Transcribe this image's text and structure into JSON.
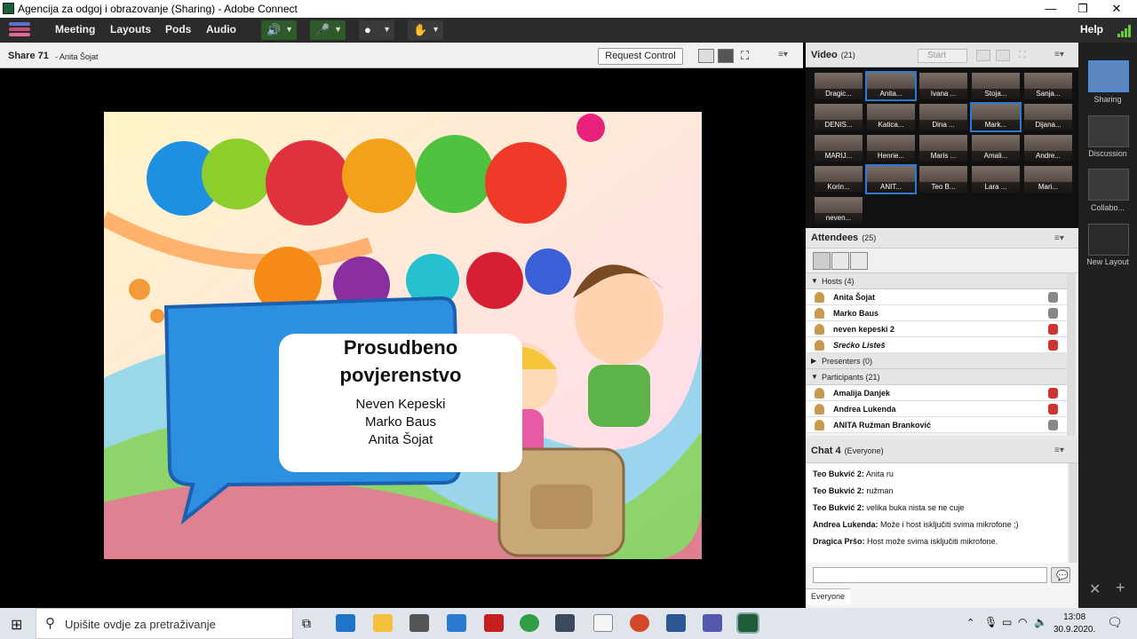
{
  "window": {
    "title": "Agencija za odgoj i obrazovanje (Sharing) - Adobe Connect",
    "minimize": "—",
    "maximize": "❐",
    "close": "✕"
  },
  "menu": {
    "items": [
      "Meeting",
      "Layouts",
      "Pods",
      "Audio"
    ],
    "help": "Help"
  },
  "share": {
    "title": "Share 71",
    "subtitle": "- Anita Šojat",
    "request_control": "Request Control",
    "menu_icon": "≡▾"
  },
  "slide": {
    "heading": [
      "Prosudbeno",
      "povjerenstvo"
    ],
    "names": [
      "Neven Kepeski",
      "Marko Baus",
      "Anita Šojat"
    ]
  },
  "video": {
    "title": "Video",
    "count": "(21)",
    "start": "Start",
    "tiles": [
      "Dragic...",
      "Anita...",
      "Ivana ...",
      "Stoja...",
      "Sanja...",
      "DENIS...",
      "Katica...",
      "Dina ...",
      "Mark...",
      "Dijana...",
      "MARIJ...",
      "Henrie...",
      "Maris ...",
      "Amali...",
      "Andre...",
      "Korin...",
      "ANIT...",
      "Teo B...",
      "Lara ...",
      "Mari...",
      "neven..."
    ],
    "highlight": [
      1,
      8,
      16
    ]
  },
  "attendees": {
    "title": "Attendees",
    "count": "(25)",
    "hosts_label": "Hosts (4)",
    "hosts": [
      "Anita Šojat",
      "Marko Baus",
      "neven kepeski 2",
      "Srećko Listeš"
    ],
    "presenters_label": "Presenters (0)",
    "participants_label": "Participants (21)",
    "participants": [
      "Amalija Danjek",
      "Andrea Lukenda",
      "ANITA Ružman Branković"
    ]
  },
  "chat": {
    "title": "Chat 4",
    "scope": "(Everyone)",
    "tab": "Everyone",
    "messages": [
      {
        "who": "Teo Bukvić 2:",
        "text": "Anita ru"
      },
      {
        "who": "Teo Bukvić 2:",
        "text": "ružman"
      },
      {
        "who": "Teo Bukvić 2:",
        "text": "velika buka nista se ne cuje"
      },
      {
        "who": "Andrea Lukenda:",
        "text": "Može i host isključiti svima mikrofone ;)"
      },
      {
        "who": "Dragica Pršo:",
        "text": "Host može svima isključiti mikrofone."
      }
    ]
  },
  "layouts": {
    "items": [
      "Sharing",
      "Discussion",
      "Collabo...",
      "New Layout"
    ]
  },
  "taskbar": {
    "search": "Upišite ovdje za pretraživanje",
    "time": "13:08",
    "date": "30.9.2020."
  }
}
